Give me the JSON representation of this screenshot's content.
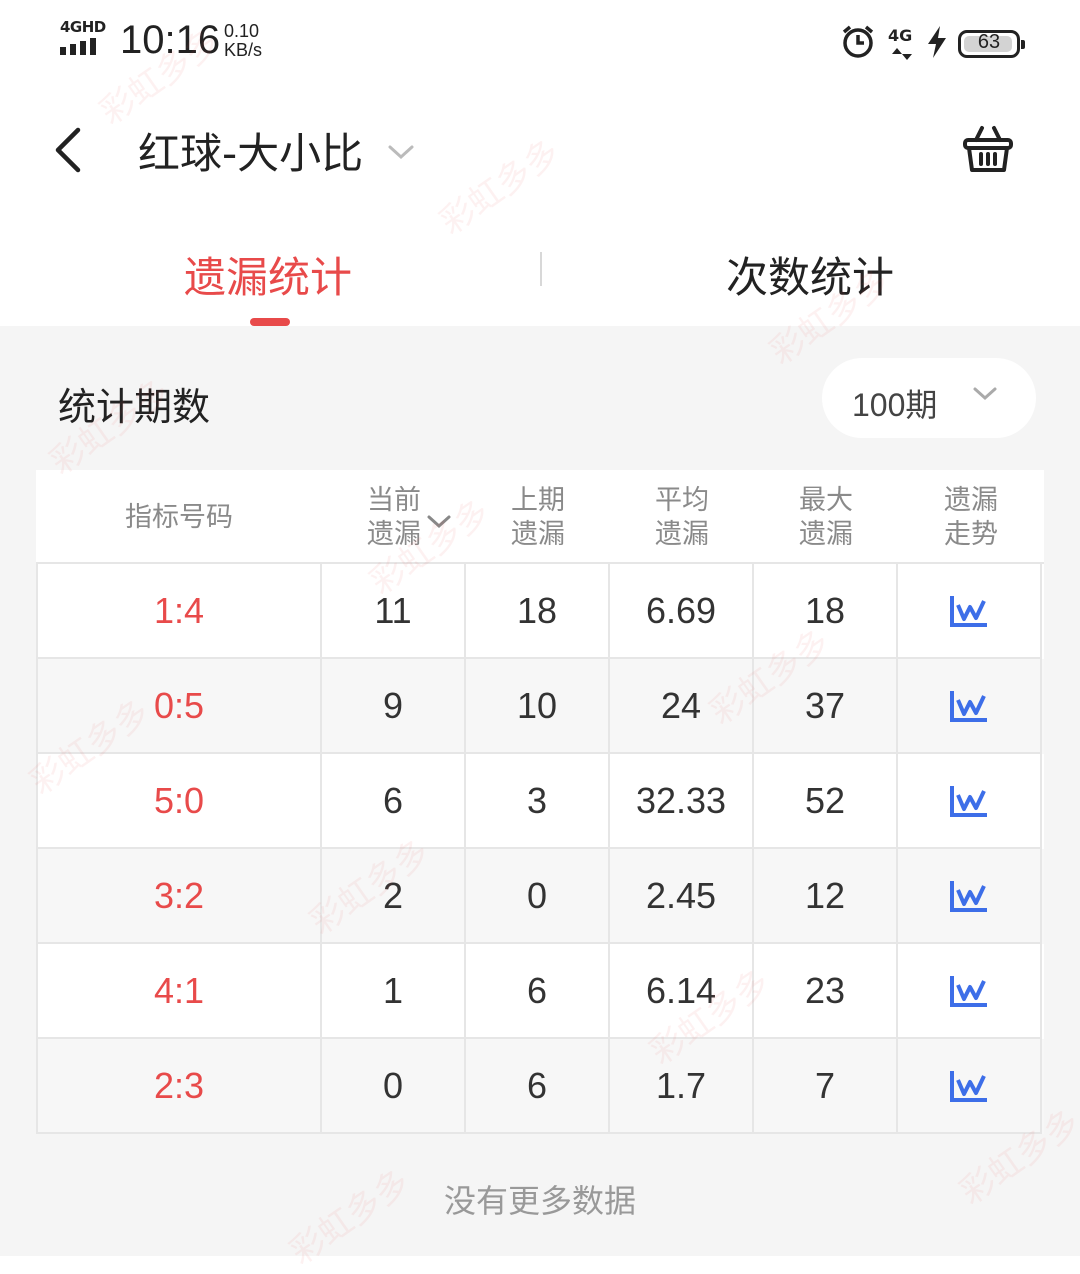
{
  "status_bar": {
    "network": "4GHD",
    "time": "10:16",
    "speed_value": "0.10",
    "speed_unit": "KB/s",
    "right_network": "4G",
    "battery": "63"
  },
  "header": {
    "title": "红球-大小比"
  },
  "tabs": [
    {
      "label": "遗漏统计",
      "active": true
    },
    {
      "label": "次数统计",
      "active": false
    }
  ],
  "period": {
    "label": "统计期数",
    "value": "100期"
  },
  "table": {
    "headers": {
      "index": "指标号码",
      "current_1": "当前",
      "current_2": "遗漏",
      "previous_1": "上期",
      "previous_2": "遗漏",
      "average_1": "平均",
      "average_2": "遗漏",
      "max_1": "最大",
      "max_2": "遗漏",
      "trend_1": "遗漏",
      "trend_2": "走势"
    },
    "rows": [
      {
        "index": "1:4",
        "current": "11",
        "previous": "18",
        "average": "6.69",
        "max": "18"
      },
      {
        "index": "0:5",
        "current": "9",
        "previous": "10",
        "average": "24",
        "max": "37"
      },
      {
        "index": "5:0",
        "current": "6",
        "previous": "3",
        "average": "32.33",
        "max": "52"
      },
      {
        "index": "3:2",
        "current": "2",
        "previous": "0",
        "average": "2.45",
        "max": "12"
      },
      {
        "index": "4:1",
        "current": "1",
        "previous": "6",
        "average": "6.14",
        "max": "23"
      },
      {
        "index": "2:3",
        "current": "0",
        "previous": "6",
        "average": "1.7",
        "max": "7"
      }
    ]
  },
  "footer": {
    "no_more": "没有更多数据"
  },
  "watermark": "彩虹多多",
  "colors": {
    "accent": "#e84a4a",
    "trend_icon": "#3d6ee8"
  }
}
